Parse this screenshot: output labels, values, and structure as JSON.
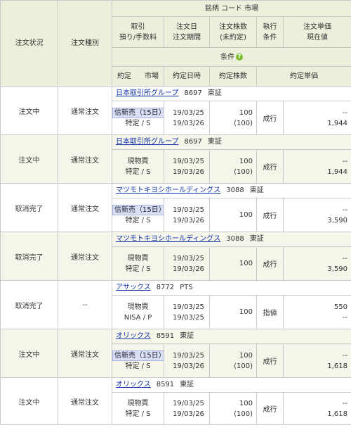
{
  "header": {
    "status": "注文状況",
    "order_type": "注文種別",
    "stock": "銘柄 コード 市場",
    "trade": [
      "取引",
      "預り/手数料"
    ],
    "order_date": [
      "注文日",
      "注文期間"
    ],
    "shares": [
      "注文株数",
      "(未約定)"
    ],
    "exec_cond": [
      "執行",
      "条件"
    ],
    "price": [
      "注文単価",
      "現在値"
    ],
    "condition": "条件",
    "sub": {
      "exec": "約定",
      "market": "市場",
      "exec_datetime": "約定日時",
      "exec_shares": "約定株数",
      "exec_price": "約定単価"
    }
  },
  "orders": [
    {
      "status": "注文中",
      "order_type": "通常注文",
      "name": "日本取引所グループ",
      "code": "8697",
      "market": "東証",
      "trade": "信新売（15日）",
      "trade_highlight": true,
      "custody": "特定 / S",
      "date": "19/03/25",
      "period": "19/03/26",
      "shares": "100",
      "unexec": "(100)",
      "exec": "成行",
      "price": "--",
      "current": "1,944"
    },
    {
      "status": "注文中",
      "order_type": "通常注文",
      "name": "日本取引所グループ",
      "code": "8697",
      "market": "東証",
      "trade": "現物買",
      "trade_highlight": false,
      "custody": "特定 / S",
      "date": "19/03/25",
      "period": "19/03/26",
      "shares": "100",
      "unexec": "(100)",
      "exec": "成行",
      "price": "--",
      "current": "1,944"
    },
    {
      "status": "取消完了",
      "order_type": "通常注文",
      "name": "マツモトキヨシホールディングス",
      "code": "3088",
      "market": "東証",
      "trade": "信新売（15日）",
      "trade_highlight": true,
      "custody": "特定 / S",
      "date": "19/03/25",
      "period": "19/03/26",
      "shares": "100",
      "unexec": "",
      "exec": "成行",
      "price": "--",
      "current": "3,590"
    },
    {
      "status": "取消完了",
      "order_type": "通常注文",
      "name": "マツモトキヨシホールディングス",
      "code": "3088",
      "market": "東証",
      "trade": "現物買",
      "trade_highlight": false,
      "custody": "特定 / S",
      "date": "19/03/25",
      "period": "19/03/26",
      "shares": "100",
      "unexec": "",
      "exec": "成行",
      "price": "--",
      "current": "3,590"
    },
    {
      "status": "取消完了",
      "order_type": "--",
      "name": "アサックス",
      "code": "8772",
      "market": "PTS",
      "trade": "現物買",
      "trade_highlight": false,
      "custody": "NISA / P",
      "date": "19/03/25",
      "period": "19/03/25",
      "shares": "100",
      "unexec": "",
      "exec": "指値",
      "price": "550",
      "current": "--"
    },
    {
      "status": "注文中",
      "order_type": "通常注文",
      "name": "オリックス",
      "code": "8591",
      "market": "東証",
      "trade": "信新売（15日）",
      "trade_highlight": true,
      "custody": "特定 / S",
      "date": "19/03/25",
      "period": "19/03/26",
      "shares": "100",
      "unexec": "(100)",
      "exec": "成行",
      "price": "--",
      "current": "1,618"
    },
    {
      "status": "注文中",
      "order_type": "通常注文",
      "name": "オリックス",
      "code": "8591",
      "market": "東証",
      "trade": "現物買",
      "trade_highlight": false,
      "custody": "特定 / S",
      "date": "19/03/25",
      "period": "19/03/26",
      "shares": "100",
      "unexec": "(100)",
      "exec": "成行",
      "price": "--",
      "current": "1,618"
    }
  ],
  "colors": {
    "header_bg": "#eeeedd",
    "row_alt_bg": "#f5f5ea",
    "link": "#1133aa",
    "highlight_bg": "#d9dff5",
    "info_icon": "#7cbf2e"
  }
}
